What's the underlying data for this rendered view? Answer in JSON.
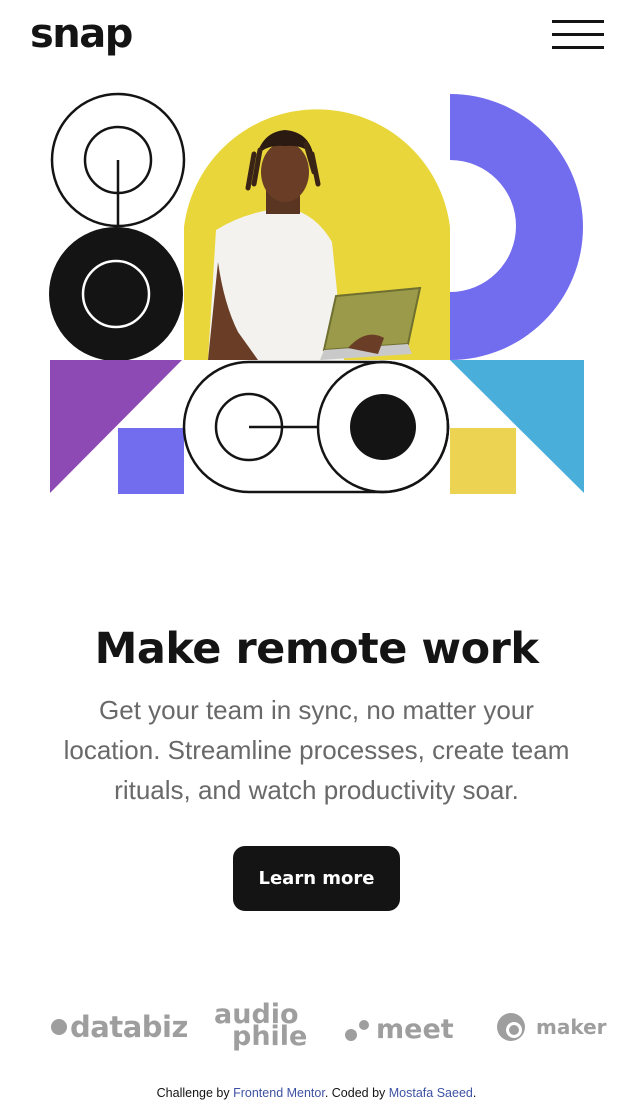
{
  "header": {
    "logo": "snap",
    "menu_icon": "hamburger-icon"
  },
  "hero": {
    "image": "person-with-laptop-geometric-illustration",
    "title": "Make remote work",
    "description": "Get your team in sync, no matter your location. Streamline processes, create team rituals, and watch productivity soar.",
    "cta_label": "Learn more"
  },
  "clients": {
    "logos": [
      {
        "name": "databiz",
        "text": "databiz",
        "icon": "databiz-logo"
      },
      {
        "name": "audiophile",
        "text_top": "audio",
        "text_bottom": "phile",
        "icon": "audiophile-logo"
      },
      {
        "name": "meet",
        "text": "meet",
        "icon": "meet-logo"
      },
      {
        "name": "maker",
        "text": "maker",
        "icon": "maker-logo"
      }
    ]
  },
  "footer": {
    "prefix": "Challenge by ",
    "link1": "Frontend Mentor",
    "middle": ". Coded by ",
    "link2": "Mostafa Saeed",
    "suffix": "."
  },
  "colors": {
    "dark": "#141414",
    "yellow": "#e9d63a",
    "purple_blue": "#726cee",
    "violet": "#8d4ab4",
    "light_blue": "#4aaedb",
    "sand": "#ecd452",
    "gray_text": "#696969",
    "logo_gray": "#9e9e9e",
    "link": "#3e52a3"
  }
}
